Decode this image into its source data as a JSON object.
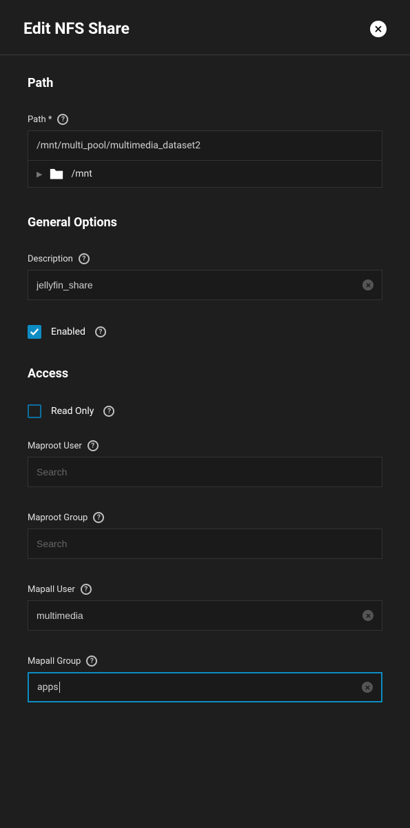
{
  "header": {
    "title": "Edit NFS Share"
  },
  "sections": {
    "path": {
      "title": "Path",
      "field_label": "Path *",
      "value": "/mnt/multi_pool/multimedia_dataset2",
      "tree_root": "/mnt"
    },
    "general": {
      "title": "General Options",
      "description_label": "Description",
      "description_value": "jellyfin_share",
      "enabled_label": "Enabled",
      "enabled_checked": true
    },
    "access": {
      "title": "Access",
      "read_only_label": "Read Only",
      "read_only_checked": false,
      "maproot_user_label": "Maproot User",
      "maproot_user_value": "",
      "maproot_user_placeholder": "Search",
      "maproot_group_label": "Maproot Group",
      "maproot_group_value": "",
      "maproot_group_placeholder": "Search",
      "mapall_user_label": "Mapall User",
      "mapall_user_value": "multimedia",
      "mapall_group_label": "Mapall Group",
      "mapall_group_value": "apps"
    }
  }
}
